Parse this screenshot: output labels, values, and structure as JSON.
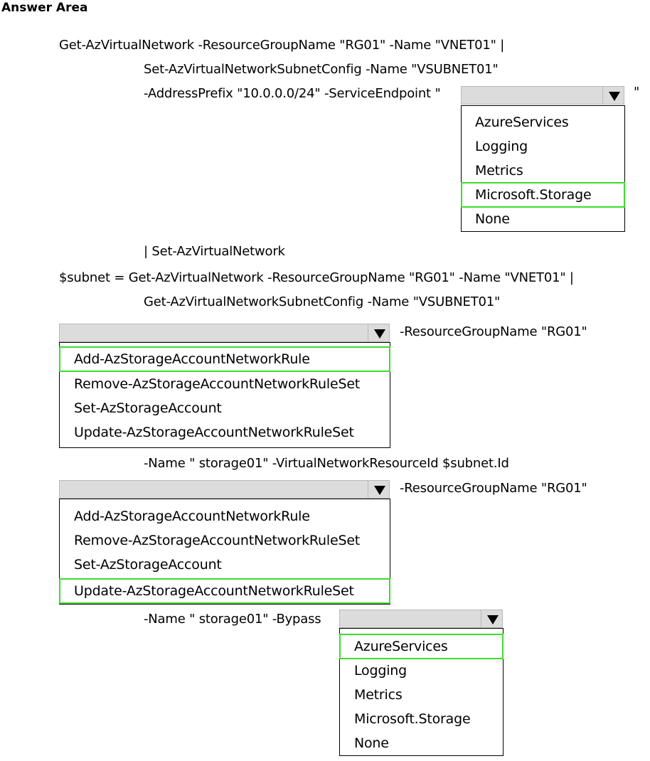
{
  "heading": "Answer Area",
  "lines": {
    "l1": "Get-AzVirtualNetwork -ResourceGroupName \"RG01\" -Name \"VNET01\" |",
    "l2": "Set-AzVirtualNetworkSubnetConfig -Name \"VSUBNET01\"",
    "l3": "-AddressPrefix \"10.0.0.0/24\" -ServiceEndpoint \"",
    "l3_close": "\"",
    "l4": "| Set-AzVirtualNetwork",
    "l5": "$subnet = Get-AzVirtualNetwork -ResourceGroupName \"RG01\" -Name \"VNET01\" |",
    "l6": "Get-AzVirtualNetworkSubnetConfig -Name \"VSUBNET01\"",
    "l7": "-ResourceGroupName \"RG01\"",
    "l8": "-Name \" storage01\" -VirtualNetworkResourceId $subnet.Id",
    "l9": "-ResourceGroupName \"RG01\"",
    "l10": "-Name \" storage01\" -Bypass"
  },
  "dropdown1": {
    "options": [
      "AzureServices",
      "Logging",
      "Metrics",
      "Microsoft.Storage",
      "None"
    ],
    "selected": "Microsoft.Storage"
  },
  "dropdown2": {
    "options": [
      "Add-AzStorageAccountNetworkRule",
      "Remove-AzStorageAccountNetworkRuleSet",
      "Set-AzStorageAccount",
      "Update-AzStorageAccountNetworkRuleSet"
    ],
    "selected": "Add-AzStorageAccountNetworkRule"
  },
  "dropdown3": {
    "options": [
      "Add-AzStorageAccountNetworkRule",
      "Remove-AzStorageAccountNetworkRuleSet",
      "Set-AzStorageAccount",
      "Update-AzStorageAccountNetworkRuleSet"
    ],
    "selected": "Update-AzStorageAccountNetworkRuleSet"
  },
  "dropdown4": {
    "options": [
      "AzureServices",
      "Logging",
      "Metrics",
      "Microsoft.Storage",
      "None"
    ],
    "selected": "AzureServices"
  },
  "colors": {
    "selection_outline": "#3ddc2e",
    "dropdown_header": "#dcdcdc"
  }
}
